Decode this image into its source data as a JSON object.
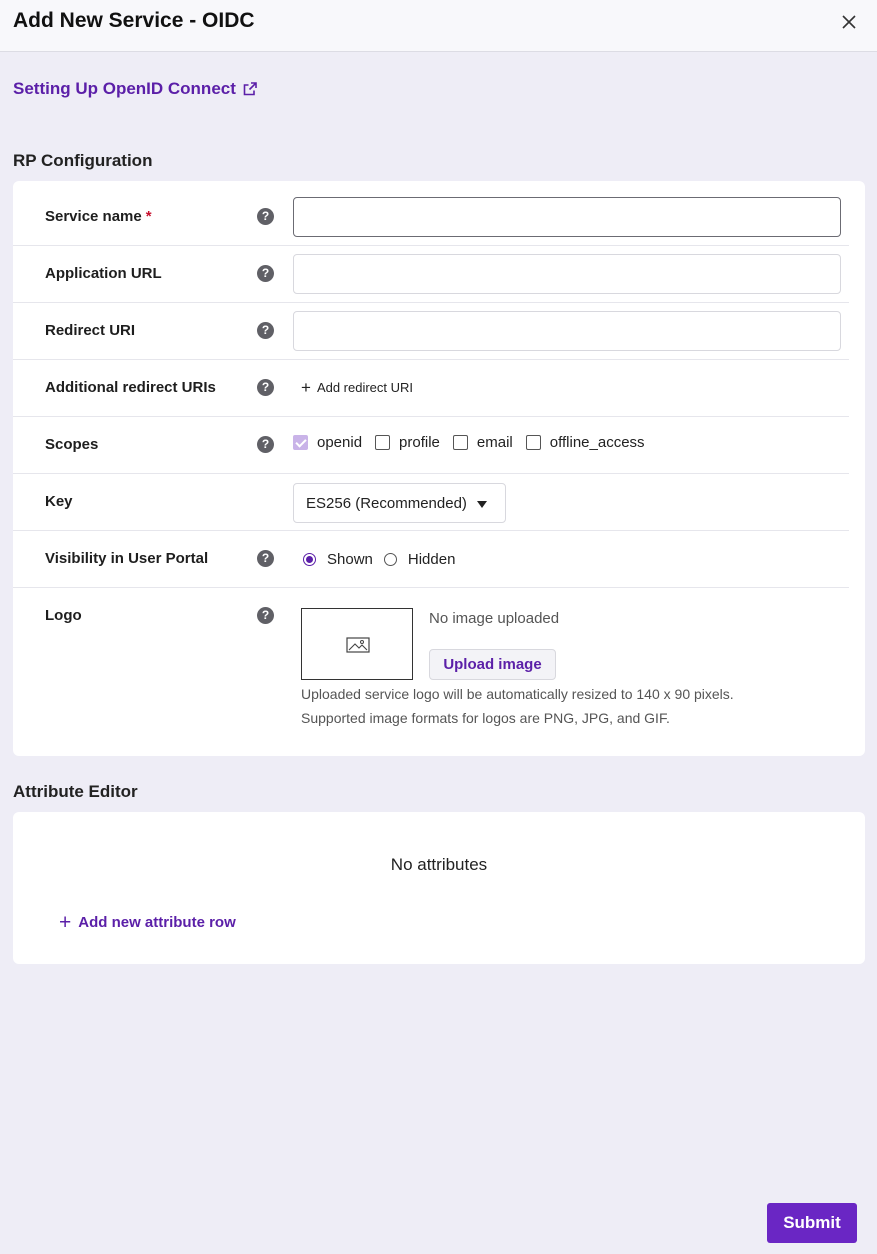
{
  "header": {
    "title": "Add New Service - OIDC",
    "close_icon": "close-icon"
  },
  "help_link": {
    "label": "Setting Up OpenID Connect",
    "icon": "external-link-icon"
  },
  "rp_config": {
    "title": "RP Configuration",
    "rows": {
      "service_name": {
        "label": "Service name",
        "required_mark": "*",
        "value": ""
      },
      "application_url": {
        "label": "Application URL",
        "value": ""
      },
      "redirect_uri": {
        "label": "Redirect URI",
        "value": ""
      },
      "additional_redirect": {
        "label": "Additional redirect URIs",
        "add_label": "Add redirect URI"
      },
      "scopes": {
        "label": "Scopes",
        "options": [
          {
            "label": "openid",
            "checked": true,
            "disabled": true
          },
          {
            "label": "profile",
            "checked": false
          },
          {
            "label": "email",
            "checked": false
          },
          {
            "label": "offline_access",
            "checked": false
          }
        ]
      },
      "key": {
        "label": "Key",
        "selected": "ES256 (Recommended)"
      },
      "visibility": {
        "label": "Visibility in User Portal",
        "options": [
          {
            "label": "Shown",
            "selected": true
          },
          {
            "label": "Hidden",
            "selected": false
          }
        ]
      },
      "logo": {
        "label": "Logo",
        "status": "No image uploaded",
        "upload_label": "Upload image",
        "note_1": "Uploaded service logo will be automatically resized to 140 x 90 pixels.",
        "note_2": "Supported image formats for logos are PNG, JPG, and GIF."
      }
    },
    "help_icon": "question-circle-icon"
  },
  "attribute_editor": {
    "title": "Attribute Editor",
    "empty_text": "No attributes",
    "add_label": "Add new attribute row"
  },
  "footer": {
    "submit_label": "Submit"
  },
  "colors": {
    "accent": "#5b1fa8",
    "submit_bg": "#6a26c4",
    "background": "#eeedf6",
    "required": "#c7102e"
  }
}
